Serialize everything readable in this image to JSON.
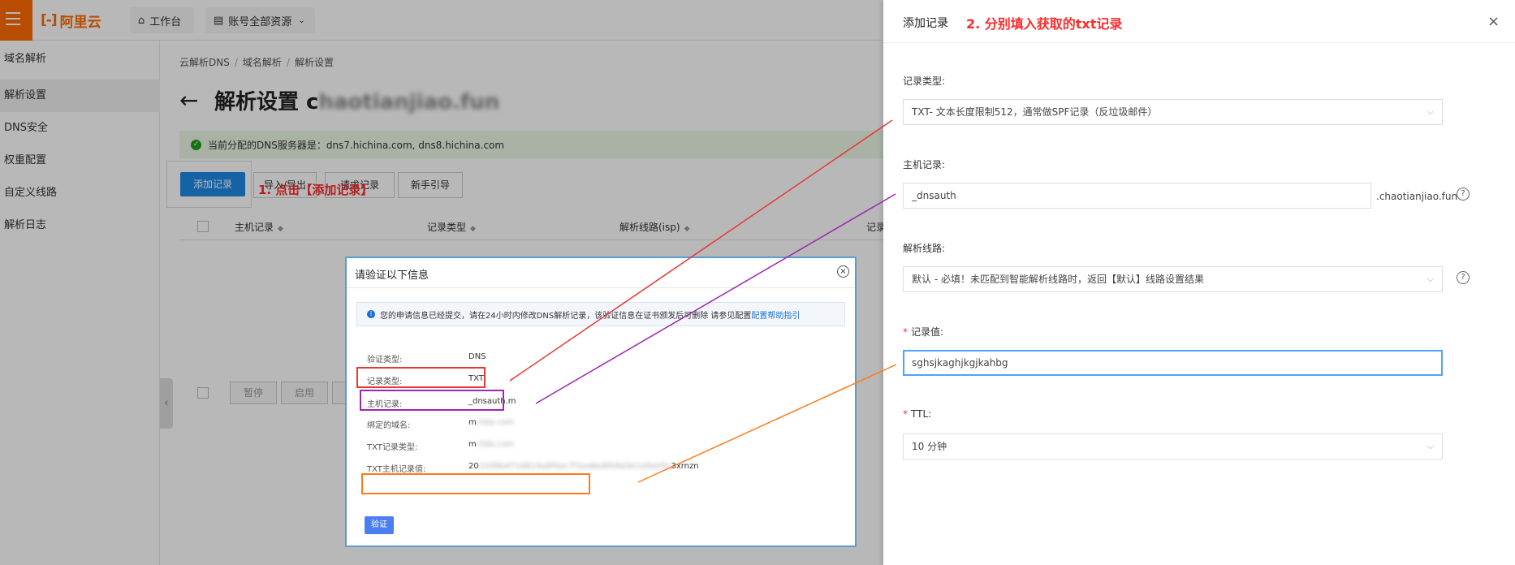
{
  "topbar": {
    "logo_mark": "[-]",
    "logo_text": "阿里云",
    "workbench_label": "工作台",
    "resources_label": "账号全部资源"
  },
  "sidebar": {
    "items": [
      {
        "label": "域名解析"
      },
      {
        "label": "解析设置"
      },
      {
        "label": "DNS安全"
      },
      {
        "label": "权重配置"
      },
      {
        "label": "自定义线路"
      },
      {
        "label": "解析日志"
      }
    ]
  },
  "breadcrumb": [
    "云解析DNS",
    "域名解析",
    "解析设置"
  ],
  "page": {
    "title": "解析设置 c",
    "title_blurred": "haotianjiao.fun",
    "dns_notice": "当前分配的DNS服务器是：dns7.hichina.com, dns8.hichina.com"
  },
  "toolbar": {
    "add_record": "添加记录",
    "import_export": "导入/导出",
    "request_record": "请求记录",
    "beginner_guide": "新手引导",
    "step1_annotation": "1. 点击【添加记录】"
  },
  "table": {
    "headers": [
      "主机记录",
      "记录类型",
      "解析线路(isp)",
      "记录"
    ]
  },
  "batch": {
    "pause": "暂停",
    "enable": "启用"
  },
  "dialog": {
    "title": "请验证以下信息",
    "info_text": "您的申请信息已经提交，请在24小时内修改DNS解析记录，该验证信息在证书颁发后可删除 请参见配置",
    "info_link": "配置帮助指引",
    "rows": [
      {
        "label": "验证类型:",
        "value": "DNS",
        "value_blurred": ""
      },
      {
        "label": "记录类型:",
        "value": "TXT",
        "value_blurred": ""
      },
      {
        "label": "主机记录:",
        "value": "_dnsauth.m",
        "value_blurred": ""
      },
      {
        "label": "绑定的域名:",
        "value": "m",
        "value_blurred": "ctda.com"
      },
      {
        "label": "TXT记录类型:",
        "value": "m",
        "value_blurred": "ctda.com"
      },
      {
        "label": "TXT主机记录值:",
        "value": "20",
        "value_blurred": "2209b4716814a9f4ac7f1ea8e8f09d3e1a5eb5e",
        "value_tail": "3xrnzn"
      }
    ],
    "verify_button": "验证"
  },
  "drawer": {
    "title": "添加记录",
    "step2_annotation": "2. 分别填入获取的txt记录",
    "close_symbol": "×",
    "record_type_label": "记录类型:",
    "record_type_value": "TXT- 文本长度限制512，通常做SPF记录（反垃圾邮件）",
    "host_label": "主机记录:",
    "host_value": "_dnsauth",
    "host_suffix": ".chaotianjiao.fun",
    "line_label": "解析线路:",
    "line_value": "默认 - 必填！未匹配到智能解析线路时，返回【默认】线路设置结果",
    "value_label": "记录值:",
    "value_value": "sghsjkaghjkgjkahbg",
    "ttl_label": "TTL:",
    "ttl_value": "10 分钟"
  },
  "colors": {
    "accent_orange": "#ff6a00",
    "primary_blue": "#1e88e5",
    "annotation_red": "#ff2a2a",
    "connector_red": "#e53935",
    "connector_purple": "#9c27b0",
    "connector_orange": "#ff7a1a"
  }
}
